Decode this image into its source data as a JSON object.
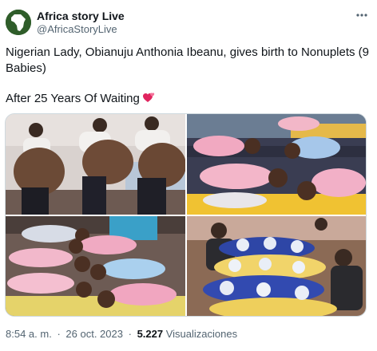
{
  "author": {
    "name": "Africa story Live",
    "handle": "@AfricaStoryLive",
    "avatar_icon": "africa-map-icon"
  },
  "more_icon": "more-horizontal-icon",
  "tweet": {
    "text_line1": "Nigerian Lady, Obianuju Anthonia Ibeanu, gives birth to Nonuplets (9 Babies)",
    "text_line2": "After 25 Years Of Waiting",
    "emoji": "two-hearts-emoji"
  },
  "media": {
    "photos": [
      {
        "label": "pregnant-woman-three-poses"
      },
      {
        "label": "babies-sleeping-on-mat"
      },
      {
        "label": "babies-lying-in-row"
      },
      {
        "label": "babies-on-pillows-with-caregivers"
      }
    ]
  },
  "meta": {
    "time": "8:54 a. m.",
    "separator": "·",
    "date": "26 oct. 2023",
    "views_count": "5.227",
    "views_label": "Visualizaciones"
  },
  "colors": {
    "text": "#0f1419",
    "secondary": "#536471",
    "border": "#cfd9de",
    "emoji_heart": "#e0245e"
  }
}
